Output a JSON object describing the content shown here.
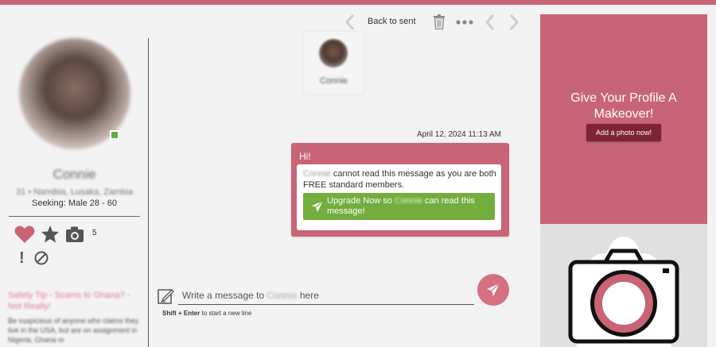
{
  "header": {
    "back_label": "Back to sent"
  },
  "profile": {
    "name": "Connie",
    "location": "31 • Namibia, Lusaka, Zambia",
    "seeking": "Seeking: Male 28 - 60",
    "photo_count": "5"
  },
  "safety": {
    "title": "Safety Tip - Scams to Ghana? - Not Really!",
    "body": "Be suspicious of anyone who claims they live in the USA, but are on assignment in Nigeria, Ghana or"
  },
  "conversation": {
    "partner_name": "Connie",
    "timestamp": "April 12, 2024 11:13 AM",
    "greeting": "Hi!",
    "notice_name": "Connie",
    "notice_text": " cannot read this message as you are both FREE standard members.",
    "upgrade_prefix": "Upgrade Now so ",
    "upgrade_name": "Connie",
    "upgrade_suffix": " can read this message!"
  },
  "composer": {
    "prefix": "Write a message to ",
    "name": "Connie",
    "suffix": " here",
    "hint_keys": "Shift + Enter",
    "hint_text": " to start a new line"
  },
  "promo": {
    "title": "Give Your Profile A Makeover!",
    "button_label": "Add a photo now!"
  },
  "colors": {
    "brand": "#c86477",
    "upgrade": "#72ad3d",
    "promo_button": "#7e2336"
  }
}
